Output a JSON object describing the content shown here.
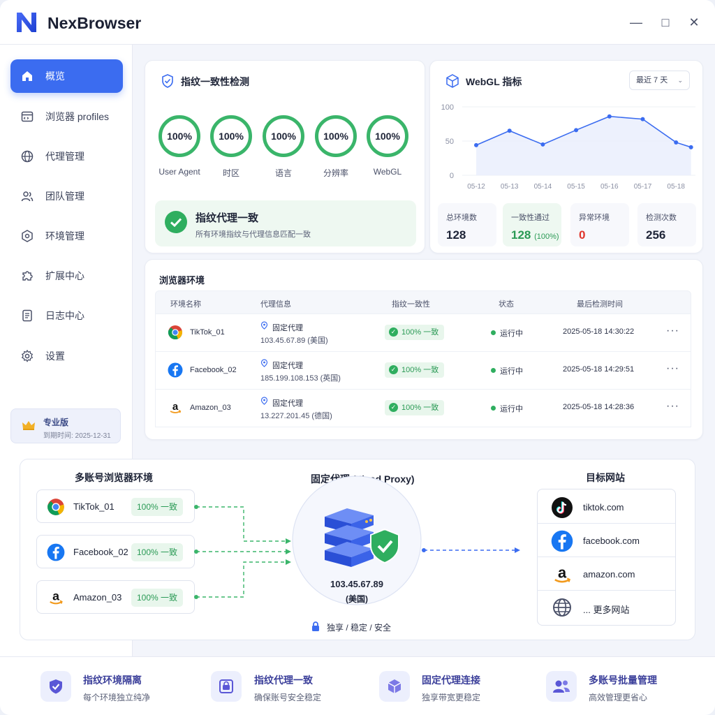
{
  "app": {
    "title": "NexBrowser"
  },
  "window_controls": {
    "minimize": "—",
    "maximize": "□",
    "close": "✕"
  },
  "sidebar": {
    "items": [
      {
        "label": "概览",
        "icon": "home-icon",
        "active": true
      },
      {
        "label": "浏览器 profiles",
        "icon": "browser-window-icon"
      },
      {
        "label": "代理管理",
        "icon": "globe-icon"
      },
      {
        "label": "团队管理",
        "icon": "users-icon"
      },
      {
        "label": "环境管理",
        "icon": "hexagon-icon"
      },
      {
        "label": "扩展中心",
        "icon": "puzzle-icon"
      },
      {
        "label": "日志中心",
        "icon": "document-icon"
      },
      {
        "label": "设置",
        "icon": "gear-icon"
      }
    ],
    "plan": {
      "name": "专业版",
      "expiry": "到期时间: 2025-12-31",
      "icon": "crown-icon"
    }
  },
  "fingerprint": {
    "title": "指纹一致性检测",
    "rings": [
      {
        "value": "100%",
        "label": "User Agent"
      },
      {
        "value": "100%",
        "label": "时区"
      },
      {
        "value": "100%",
        "label": "语言"
      },
      {
        "value": "100%",
        "label": "分辨率"
      },
      {
        "value": "100%",
        "label": "WebGL"
      }
    ],
    "status_title": "指纹代理一致",
    "status_sub": "所有环境指纹与代理信息匹配一致"
  },
  "webgl": {
    "title": "WebGL 指标",
    "range_select": "最近 7 天"
  },
  "chart_data": {
    "type": "area",
    "x": [
      "05-12",
      "05-13",
      "05-14",
      "05-15",
      "05-16",
      "05-17",
      "05-18"
    ],
    "series": [
      {
        "values": [
          44,
          65,
          45,
          66,
          86,
          82,
          48,
          41
        ]
      }
    ],
    "x_points": [
      0,
      1,
      2,
      3,
      4,
      5,
      6,
      6.45
    ],
    "ylim": [
      0,
      100
    ],
    "yticks": [
      "100",
      "50",
      "0"
    ],
    "colors": {
      "line": "#3b6cf0",
      "fill": "#e8edfc"
    }
  },
  "stats": [
    {
      "label": "总环境数",
      "value": "128",
      "extra": ""
    },
    {
      "label": "一致性通过",
      "value": "128",
      "extra": "(100%)"
    },
    {
      "label": "异常环境",
      "value": "0",
      "extra": ""
    },
    {
      "label": "检测次数",
      "value": "256",
      "extra": ""
    }
  ],
  "env_table": {
    "title": "浏览器环境",
    "headers": [
      "环境名称",
      "代理信息",
      "指纹一致性",
      "状态",
      "最后检测时间"
    ],
    "rows": [
      {
        "name": "TikTok_01",
        "icon": "chrome-icon",
        "proxy_type": "固定代理",
        "proxy_ip": "103.45.67.89 (美国)",
        "consistency": "100% 一致",
        "status": "运行中",
        "time": "2025-05-18 14:30:22"
      },
      {
        "name": "Facebook_02",
        "icon": "facebook-icon",
        "proxy_type": "固定代理",
        "proxy_ip": "185.199.108.153 (英国)",
        "consistency": "100% 一致",
        "status": "运行中",
        "time": "2025-05-18 14:29:51"
      },
      {
        "name": "Amazon_03",
        "icon": "amazon-icon",
        "proxy_type": "固定代理",
        "proxy_ip": "13.227.201.45 (德国)",
        "consistency": "100% 一致",
        "status": "运行中",
        "time": "2025-05-18 14:28:36"
      }
    ],
    "more": "···"
  },
  "diagram": {
    "left_title": "多账号浏览器环境",
    "center_title": "固定代理 (Fixed Proxy)",
    "right_title": "目标网站",
    "accounts": [
      {
        "name": "TikTok_01",
        "badge": "100% 一致",
        "icon": "chrome-icon"
      },
      {
        "name": "Facebook_02",
        "badge": "100% 一致",
        "icon": "facebook-icon"
      },
      {
        "name": "Amazon_03",
        "badge": "100% 一致",
        "icon": "amazon-icon"
      }
    ],
    "proxy_ip": "103.45.67.89",
    "proxy_region": "(美国)",
    "proxy_tags": "独享 / 稳定 / 安全",
    "sites": [
      {
        "name": "tiktok.com",
        "icon": "tiktok-icon"
      },
      {
        "name": "facebook.com",
        "icon": "facebook-icon"
      },
      {
        "name": "amazon.com",
        "icon": "amazon-icon"
      },
      {
        "name": "... 更多网站",
        "icon": "globe-icon"
      }
    ]
  },
  "features": [
    {
      "title": "指纹环境隔离",
      "sub": "每个环境独立纯净",
      "icon": "shield-check-icon"
    },
    {
      "title": "指纹代理一致",
      "sub": "确保账号安全稳定",
      "icon": "safe-icon"
    },
    {
      "title": "固定代理连接",
      "sub": "独享带宽更稳定",
      "icon": "cube-icon"
    },
    {
      "title": "多账号批量管理",
      "sub": "高效管理更省心",
      "icon": "users-icon"
    }
  ]
}
